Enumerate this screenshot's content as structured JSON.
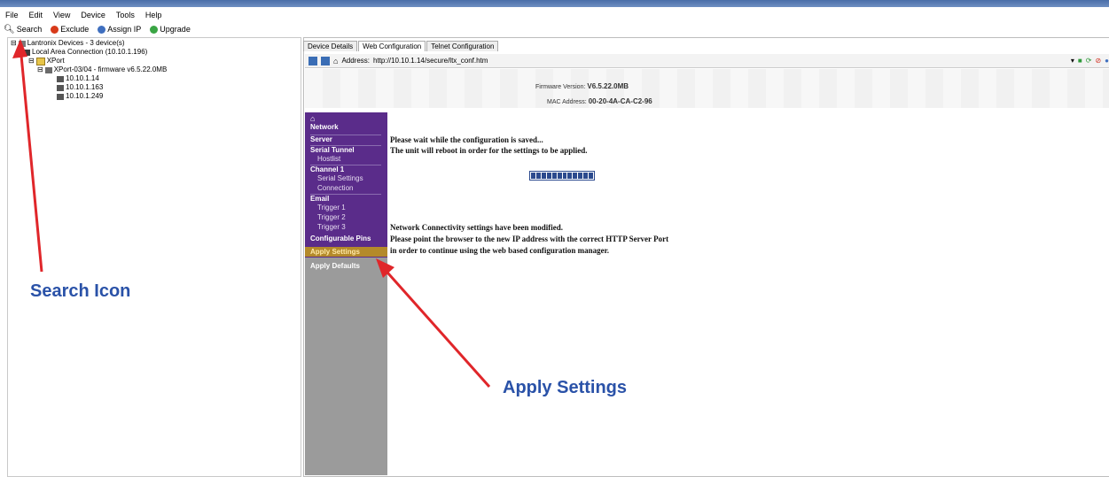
{
  "menu": {
    "file": "File",
    "edit": "Edit",
    "view": "View",
    "device": "Device",
    "tools": "Tools",
    "help": "Help"
  },
  "toolbar": {
    "search": "Search",
    "exclude": "Exclude",
    "assign_ip": "Assign IP",
    "upgrade": "Upgrade"
  },
  "tree": {
    "root": "Lantronix Devices - 3 device(s)",
    "connection": "Local Area Connection (10.10.1.196)",
    "group": "XPort",
    "device": "XPort-03/04 - firmware v6.5.22.0MB",
    "ips": [
      "10.10.1.14",
      "10.10.1.163",
      "10.10.1.249"
    ]
  },
  "tabs": [
    "Device Details",
    "Web Configuration",
    "Telnet Configuration"
  ],
  "address": {
    "label": "Address:",
    "url": "http://10.10.1.14/secure/ltx_conf.htm"
  },
  "header": {
    "fw_label": "Firmware Version:",
    "fw_value": "V6.5.22.0MB",
    "mac_label": "MAC Address:",
    "mac_value": "00-20-4A-CA-C2-96"
  },
  "sidemenu": {
    "network": "Network",
    "server": "Server",
    "serial_tunnel": "Serial Tunnel",
    "hostlist": "Hostlist",
    "channel1": "Channel 1",
    "serial_settings": "Serial Settings",
    "connection": "Connection",
    "email": "Email",
    "trigger1": "Trigger 1",
    "trigger2": "Trigger 2",
    "trigger3": "Trigger 3",
    "configurable_pins": "Configurable Pins",
    "apply_settings": "Apply Settings",
    "apply_defaults": "Apply Defaults"
  },
  "content": {
    "line1": "Please wait while the configuration is saved...",
    "line2": "The unit will reboot in order for the settings to be applied.",
    "line3": "Network Connectivity settings have been modified.",
    "line4": "Please point the browser to the new IP address with the correct HTTP Server Port",
    "line5": "in order to continue using the web based configuration manager."
  },
  "callouts": {
    "search": "Search Icon",
    "apply": "Apply Settings"
  },
  "colors": {
    "menu_purple": "#5a2c8a",
    "callout_blue": "#2a52a8",
    "arrow_red": "#e0262a",
    "apply_highlight": "#b48a2a"
  }
}
